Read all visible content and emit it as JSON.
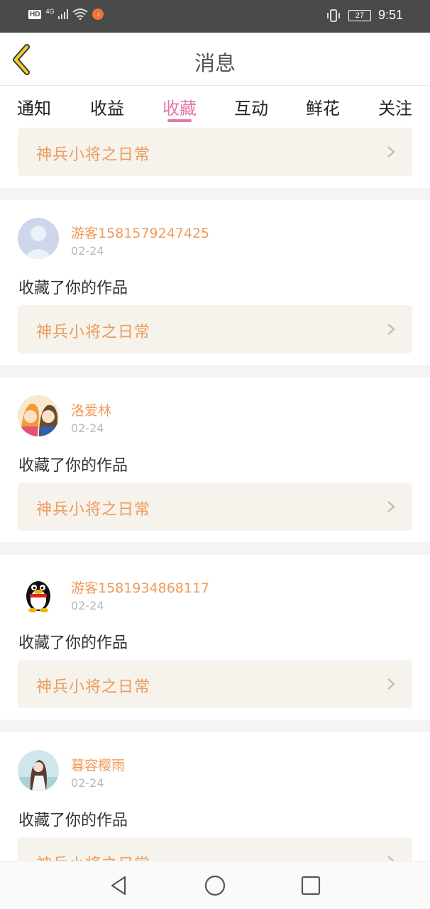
{
  "status_bar": {
    "hd": "HD",
    "network": "4G",
    "time": "9:51",
    "battery": "27"
  },
  "header": {
    "title": "消息"
  },
  "tabs": [
    {
      "label": "通知"
    },
    {
      "label": "收益"
    },
    {
      "label": "收藏"
    },
    {
      "label": "互动"
    },
    {
      "label": "鲜花"
    },
    {
      "label": "关注"
    }
  ],
  "active_tab": "收藏",
  "colors": {
    "accent": "#e478a8",
    "link": "#ef9a5b",
    "card_bg": "#f5f3eb"
  },
  "partial_top_item": {
    "work_title": "神兵小将之日常"
  },
  "messages": [
    {
      "user": "游客1581579247425",
      "date": "02-24",
      "text": "收藏了你的作品",
      "work_title": "神兵小将之日常",
      "avatar": "default-user-avatar"
    },
    {
      "user": "洛爱林",
      "date": "02-24",
      "text": "收藏了你的作品",
      "work_title": "神兵小将之日常",
      "avatar": "anime-couple-avatar"
    },
    {
      "user": "游客1581934868117",
      "date": "02-24",
      "text": "收藏了你的作品",
      "work_title": "神兵小将之日常",
      "avatar": "penguin-avatar"
    },
    {
      "user": "暮容樱雨",
      "date": "02-24",
      "text": "收藏了你的作品",
      "work_title": "神兵小将之日常",
      "avatar": "girl-avatar"
    }
  ]
}
